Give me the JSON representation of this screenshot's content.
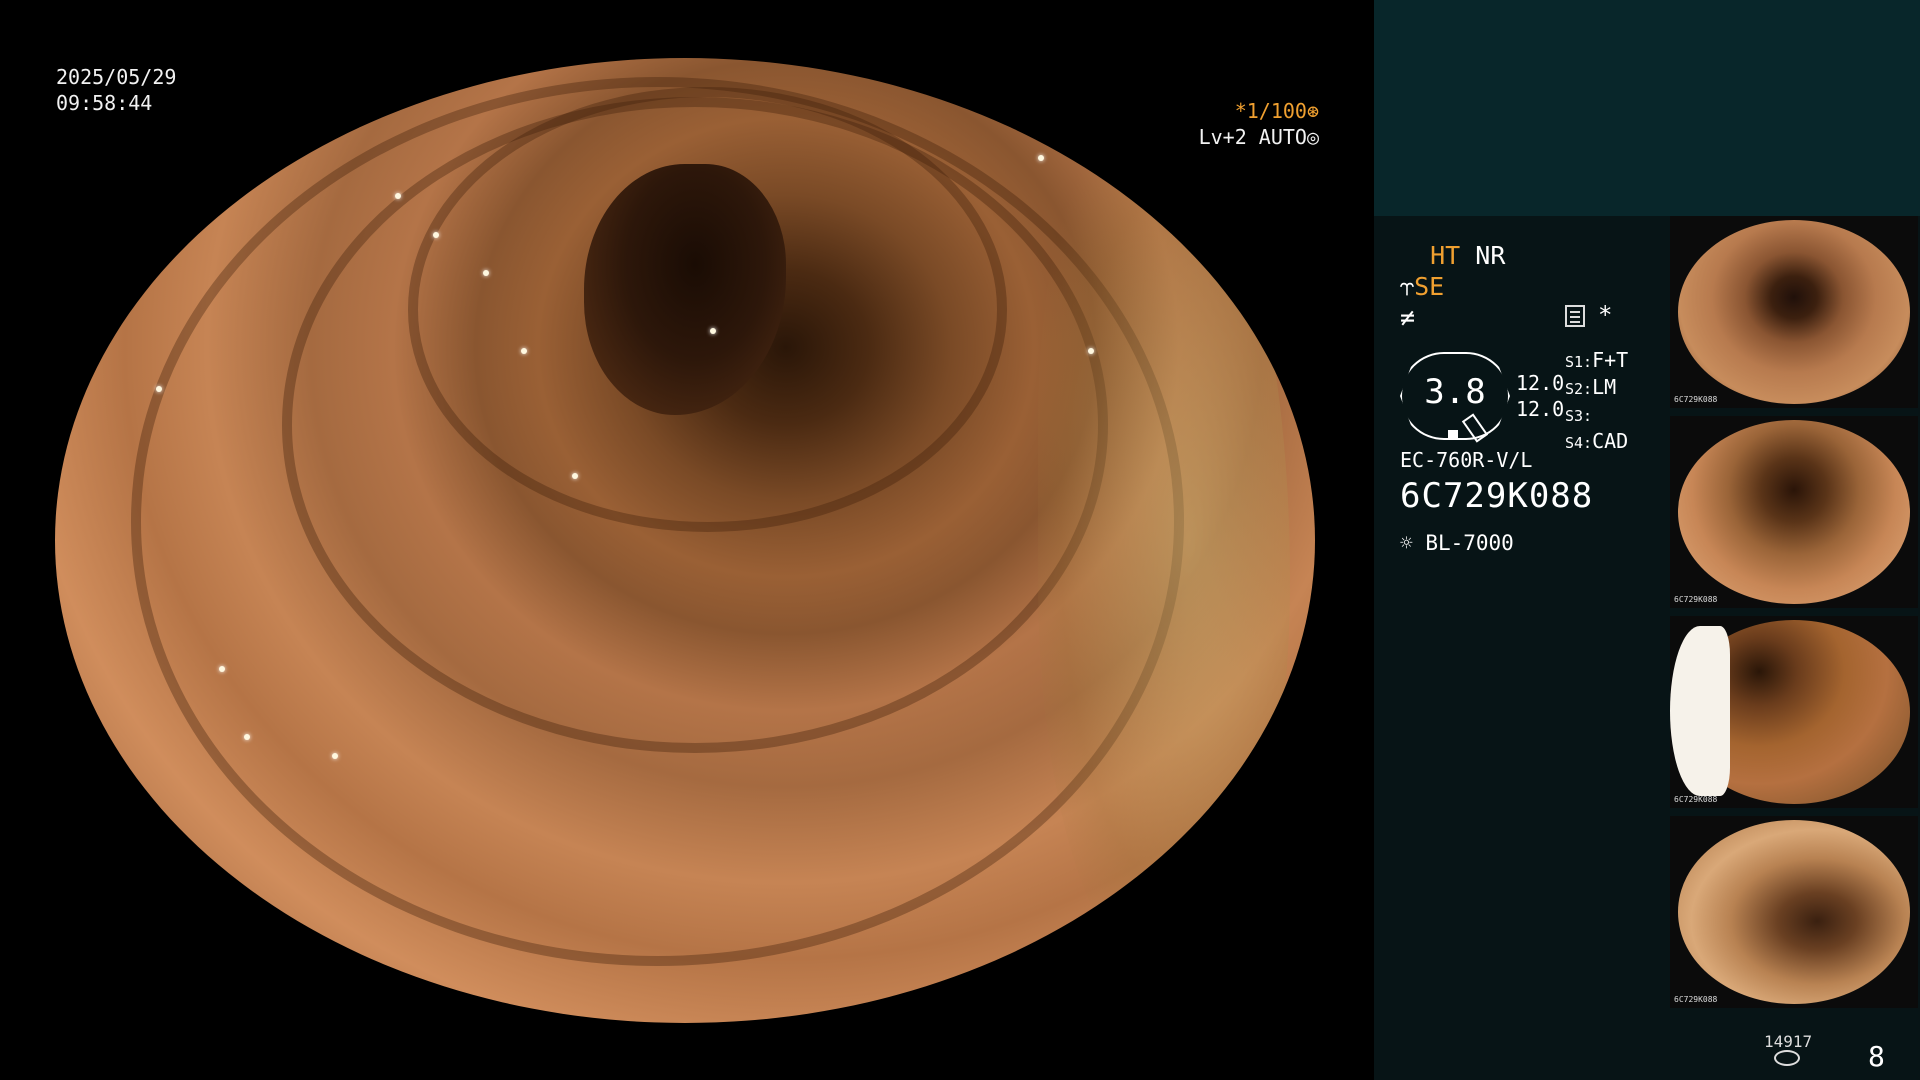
{
  "overlay": {
    "date": "2025/05/29",
    "time": "09:58:44",
    "shutter": "*1/100",
    "level": "Lv+2 AUTO"
  },
  "panel": {
    "mode_ht": "HT",
    "mode_nr": "NR",
    "mode_se": "SE",
    "star": "*",
    "zoom_value": "3.8",
    "values": [
      "12.0",
      "12.0"
    ],
    "switches": [
      {
        "key": "S1:",
        "value": "F+T"
      },
      {
        "key": "S2:",
        "value": "LM"
      },
      {
        "key": "S3:",
        "value": ""
      },
      {
        "key": "S4:",
        "value": "CAD"
      }
    ],
    "scope_model": "EC-760R-V/L",
    "scope_serial": "6C729K088",
    "light_source": "BL-7000",
    "thumbnail_label": "6C729K088",
    "image_count": "14917",
    "page_number": "8"
  }
}
